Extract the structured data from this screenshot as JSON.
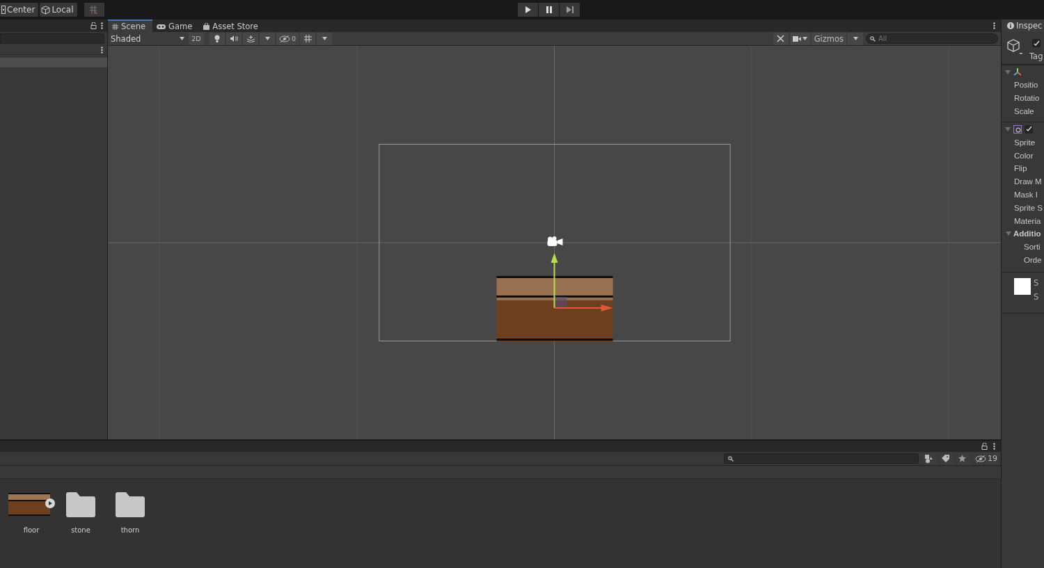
{
  "toolbar": {
    "pivot_buttons": [
      {
        "label": "Center",
        "kind": "pivot"
      },
      {
        "label": "Local",
        "kind": "space"
      }
    ]
  },
  "hierarchy": {
    "rows": [
      {
        "selected": true
      }
    ]
  },
  "scene_tabs": [
    {
      "label": "Scene",
      "kind": "scene",
      "selected": true
    },
    {
      "label": "Game",
      "kind": "game",
      "selected": false
    },
    {
      "label": "Asset Store",
      "kind": "store",
      "selected": false
    }
  ],
  "scene_toolbar": {
    "shading": "Shaded",
    "mode_2d": "2D",
    "hidden_count": "0",
    "gizmos": "Gizmos",
    "search_placeholder": "All"
  },
  "inspector": {
    "tab": "Inspec",
    "active_checked": true,
    "tag_label": "Tag",
    "transform_fields": [
      "Positio",
      "Rotatio",
      "Scale"
    ],
    "sprite_renderer_enabled": true,
    "sprite_fields": [
      "Sprite",
      "Color",
      "Flip",
      "Draw M",
      "Mask I",
      "Sprite S",
      "Materia"
    ],
    "additional": {
      "label": "Additio",
      "expanded": true,
      "fields": [
        "Sorti",
        "Orde"
      ]
    },
    "preview_lines": [
      "S",
      "S"
    ]
  },
  "project": {
    "hidden_count": "19",
    "assets": [
      {
        "name": "floor",
        "kind": "sprite"
      },
      {
        "name": "stone",
        "kind": "folder"
      },
      {
        "name": "thorn",
        "kind": "folder"
      }
    ]
  }
}
